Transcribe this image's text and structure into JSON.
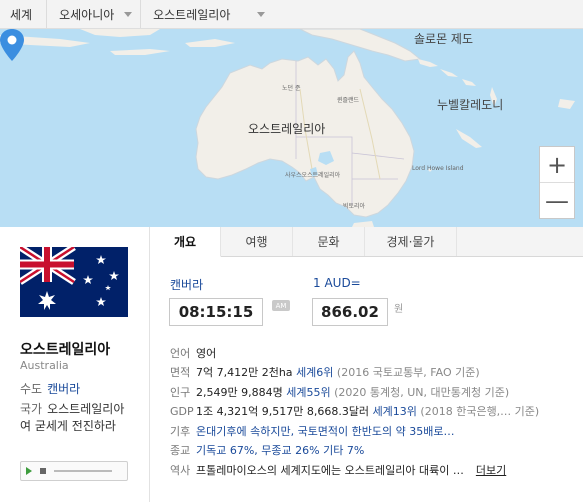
{
  "breadcrumb": {
    "world": "세계",
    "region": "오세아니아",
    "country": "오스트레일리아"
  },
  "map": {
    "labels": {
      "solomon": "솔로몬 제도",
      "new_caledonia": "누벨칼레도니",
      "country": "오스트레일리아",
      "northern_territory": "노던 준",
      "queensland": "퀸즐랜드",
      "south_australia": "사우스오스트레일리아",
      "victoria": "빅토리아",
      "lord_howe": "Lord Howe Island"
    },
    "zoom_in": "+",
    "zoom_out": "—"
  },
  "profile": {
    "name_ko": "오스트레일리아",
    "name_en": "Australia",
    "capital_key": "수도",
    "capital": "캔버라",
    "anthem_key": "국가",
    "anthem": "오스트레일리아여 굳세게 전진하라"
  },
  "tabs": [
    {
      "label": "개요",
      "active": true
    },
    {
      "label": "여행",
      "active": false
    },
    {
      "label": "문화",
      "active": false
    },
    {
      "label": "경제·물가",
      "active": false
    }
  ],
  "summary": {
    "city": "캔버라",
    "time": "08:15:15",
    "ampm": "AM",
    "currency_label": "1 AUD=",
    "rate": "866.02",
    "unit": "원"
  },
  "info": {
    "language": {
      "k": "언어",
      "v": "영어"
    },
    "area": {
      "k": "면적",
      "v": "7억 7,412만 2천ha",
      "rank": "세계6위",
      "source": "(2016 국토교통부, FAO 기준)"
    },
    "population": {
      "k": "인구",
      "v": "2,549만 9,884명",
      "rank": "세계55위",
      "source": "(2020 통계청, UN, 대만통계청 기준)"
    },
    "gdp": {
      "k": "GDP",
      "v": "1조 4,321억 9,517만 8,668.3달러",
      "rank": "세계13위",
      "source": "(2018 한국은행,… 기준)"
    },
    "climate": {
      "k": "기후",
      "v": "온대기후에 속하지만, 국토면적이 한반도의 약 35배로…"
    },
    "religion": {
      "k": "종교",
      "v": "기독교 67%, 무종교 26% 기타 7%"
    },
    "history": {
      "k": "역사",
      "v": "프톨레마이오스의 세계지도에는 오스트레일리아 대륙이 …",
      "more": "더보기"
    }
  },
  "colors": {
    "link": "#1a4a9a",
    "map_sea": "#b8def4",
    "map_land": "#f2efe9",
    "pin": "#3b8ee0",
    "play": "#3d9c3d"
  }
}
